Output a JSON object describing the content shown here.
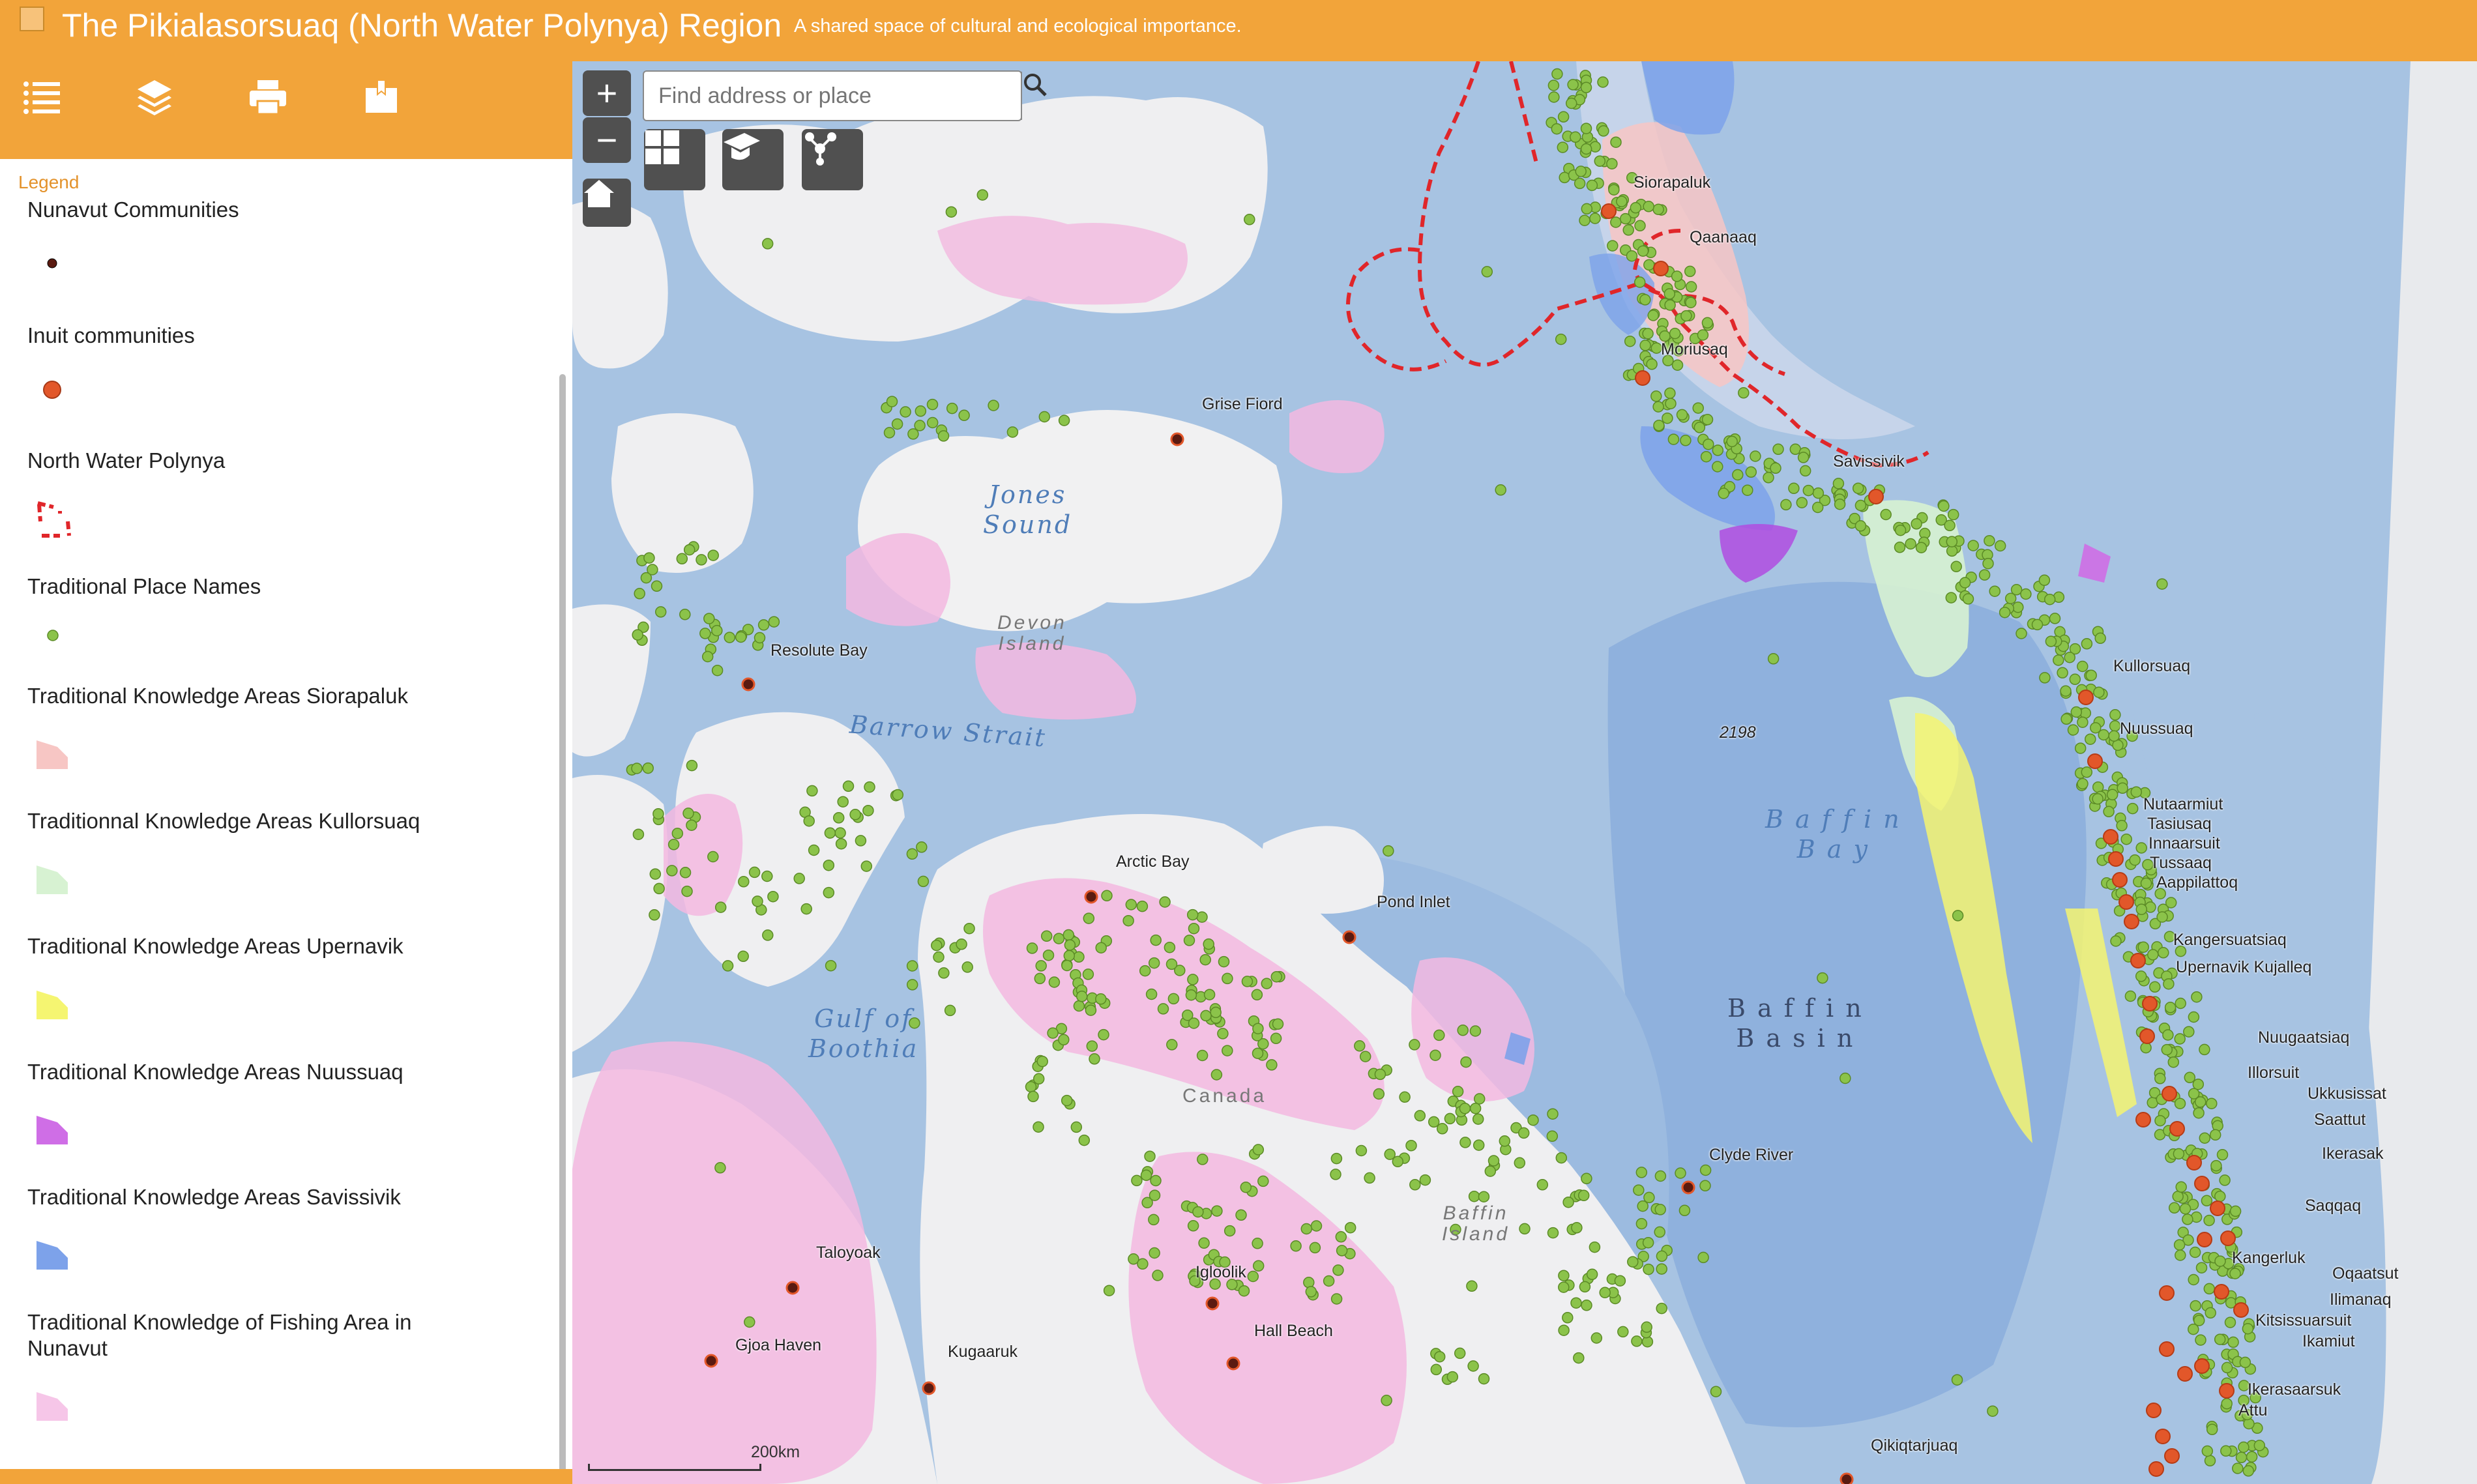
{
  "header": {
    "title": "The Pikialasorsuaq (North Water Polynya) Region",
    "subtitle": "A shared space of cultural and ecological importance."
  },
  "toolbar": {
    "items": [
      {
        "icon": "list-icon"
      },
      {
        "icon": "layers-icon"
      },
      {
        "icon": "print-icon"
      },
      {
        "icon": "bookmark-icon"
      }
    ]
  },
  "legend": {
    "tab_label": "Legend",
    "items": [
      {
        "label": "Nunavut Communities",
        "swatch": "dark-dot",
        "color": "#5a1a10"
      },
      {
        "label": "Inuit communities",
        "swatch": "orange-dot",
        "color": "#e2572a"
      },
      {
        "label": "North Water Polynya",
        "swatch": "red-dashed-polygon",
        "color": "#e0262a"
      },
      {
        "label": "Traditional Place Names",
        "swatch": "green-dot",
        "color": "#8bc34a"
      },
      {
        "label": "Traditional Knowledge Areas Siorapaluk",
        "swatch": "polygon",
        "color": "#f7c6c4"
      },
      {
        "label": "Traditionnal Knowledge Areas Kullorsuaq",
        "swatch": "polygon",
        "color": "#d7f2d2"
      },
      {
        "label": "Traditional Knowledge Areas Upernavik",
        "swatch": "polygon",
        "color": "#f5f571"
      },
      {
        "label": "Traditional Knowledge Areas Nuussuaq",
        "swatch": "polygon",
        "color": "#cf6ee6"
      },
      {
        "label": "Traditional Knowledge Areas Savissivik",
        "swatch": "polygon",
        "color": "#7da2ea"
      },
      {
        "label": "Traditional Knowledge of Fishing Area in Nunavut",
        "swatch": "polygon",
        "color": "#f6c6e8"
      }
    ]
  },
  "map": {
    "search_placeholder": "Find address or place",
    "zoom_in": "+",
    "zoom_out": "−",
    "scale_label": "200km",
    "water_labels": {
      "jones_sound": "Jones\nSound",
      "barrow_strait": "Barrow Strait",
      "gulf_of_boothia": "Gulf of\nBoothia",
      "baffin_bay": "B a f f i n\nB a y",
      "baffin_basin": "B a f f i n\nB a s i n",
      "depth": "2198"
    },
    "land_labels": {
      "devon_island": "Devon\nIsland",
      "baffin_island": "Baffin\nIsland",
      "canada": "Canada"
    },
    "places": [
      "Siorapaluk",
      "Qaanaaq",
      "Moriusaq",
      "Savissivik",
      "Grise Fiord",
      "Resolute Bay",
      "Kullorsuaq",
      "Nuussuaq",
      "Nutaarmiut",
      "Tasiusaq",
      "Innaarsuit",
      "Tussaaq",
      "Aappilattoq",
      "Kangersuatsiaq",
      "Upernavik Kujalleq",
      "Nuugaatsiaq",
      "Illorsuit",
      "Ukkusissat",
      "Saattut",
      "Ikerasak",
      "Saqqaq",
      "Kangerluk",
      "Oqaatsut",
      "Ilimanaq",
      "Kitsissuarsuit",
      "Ikamiut",
      "Ikerasaarsuk",
      "Attu",
      "Arctic Bay",
      "Pond Inlet",
      "Clyde River",
      "Taloyoak",
      "Igloolik",
      "Hall Beach",
      "Gjoa Haven",
      "Kugaaruk",
      "Qikiqtarjuaq"
    ]
  }
}
